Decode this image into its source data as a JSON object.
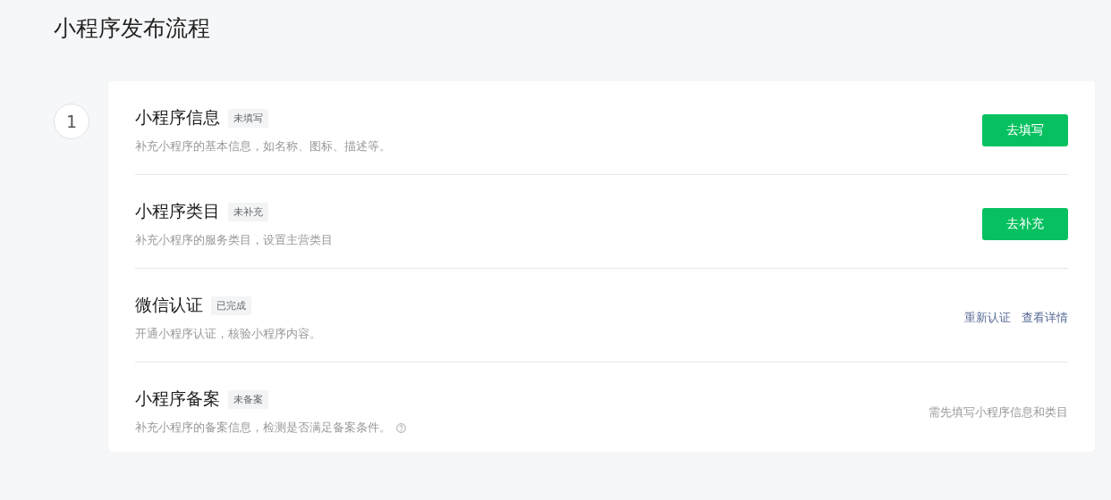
{
  "page_title": "小程序发布流程",
  "step": {
    "number": "1"
  },
  "rows": [
    {
      "kind": "button",
      "title": "小程序信息",
      "tag": "未填写",
      "description": "补充小程序的基本信息，如名称、图标、描述等。",
      "help": false,
      "button": "去填写"
    },
    {
      "kind": "button",
      "title": "小程序类目",
      "tag": "未补充",
      "description": "补充小程序的服务类目，设置主营类目",
      "help": false,
      "button": "去补充"
    },
    {
      "kind": "links",
      "title": "微信认证",
      "tag": "已完成",
      "description": "开通小程序认证，核验小程序内容。",
      "help": false,
      "links": [
        "重新认证",
        "查看详情"
      ]
    },
    {
      "kind": "note",
      "title": "小程序备案",
      "tag": "未备案",
      "description": "补充小程序的备案信息，检测是否满足备案条件。",
      "help": true,
      "note": "需先填写小程序信息和类目"
    }
  ]
}
